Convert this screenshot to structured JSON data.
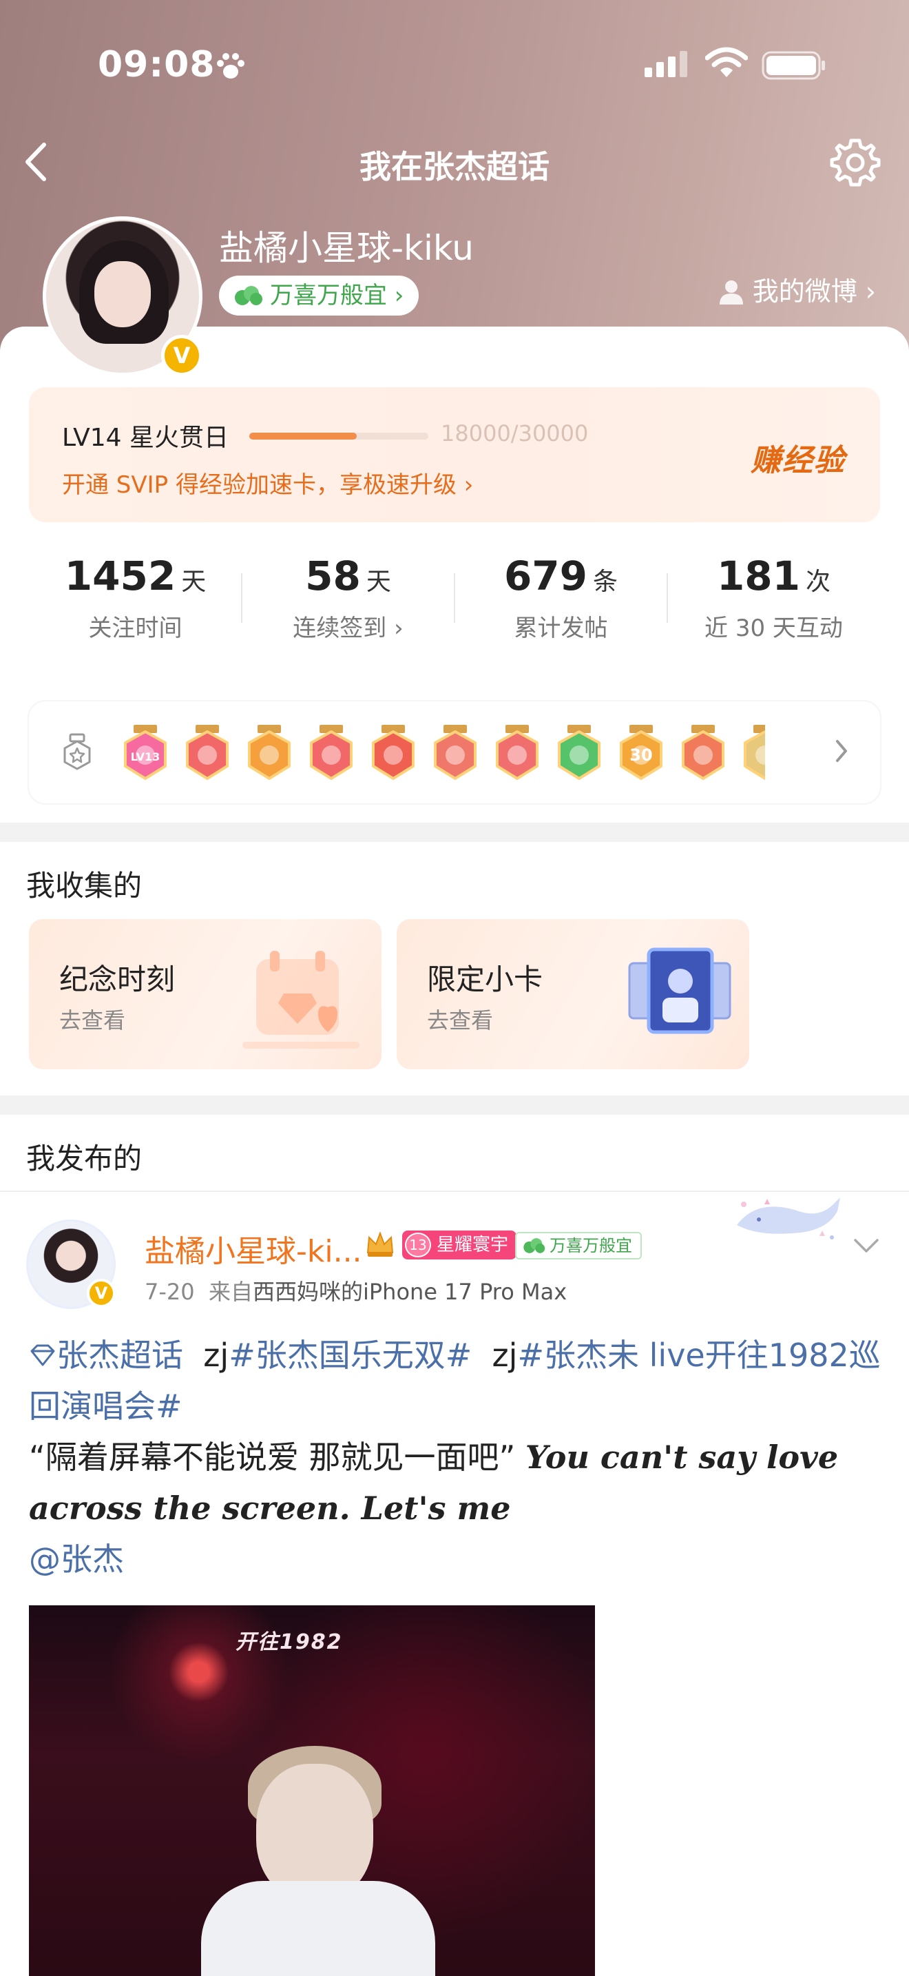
{
  "status_bar": {
    "time": "09:08"
  },
  "nav": {
    "title": "我在张杰超话"
  },
  "profile": {
    "username": "盐橘小星球-kiku",
    "fan_club": "万喜万般宜",
    "my_weibo": "我的微博",
    "verified_badge": "V"
  },
  "level": {
    "label": "LV14 星火贯日",
    "progress": "18000/30000",
    "progress_fraction": 0.6,
    "svip_text": "开通 SVIP 得经验加速卡，享极速升级",
    "earn_label": "赚经验"
  },
  "stats": [
    {
      "value": "1452",
      "unit": "天",
      "label": "关注时间"
    },
    {
      "value": "58",
      "unit": "天",
      "label": "连续签到"
    },
    {
      "value": "679",
      "unit": "条",
      "label": "累计发帖"
    },
    {
      "value": "181",
      "unit": "次",
      "label": "近 30 天互动"
    }
  ],
  "badges": {
    "colors": [
      "#f66aa0",
      "#f26868",
      "#f5a03c",
      "#f26868",
      "#f06050",
      "#f0786a",
      "#f06e6e",
      "#56c36a",
      "#f5a83a",
      "#f07a5a",
      "#e8c87a"
    ],
    "icons": [
      "lv-badge",
      "heart-badge",
      "crown-badge",
      "cat-badge",
      "rabbit-badge",
      "fox-badge",
      "panda-badge",
      "hand-badge",
      "30-days-badge",
      "hand-heart-badge",
      "badge"
    ],
    "texts": [
      "LV13",
      "",
      "",
      "",
      "",
      "",
      "",
      "",
      "30",
      "",
      ""
    ]
  },
  "collection": {
    "title": "我收集的",
    "tiles": [
      {
        "title": "纪念时刻",
        "sub": "去查看"
      },
      {
        "title": "限定小卡",
        "sub": "去查看"
      }
    ]
  },
  "published": {
    "title": "我发布的",
    "post": {
      "author": "盐橘小星球-ki...",
      "star_tag_level": "13",
      "star_tag": "星耀寰宇",
      "fan_tag": "万喜万般宜",
      "date": "7-20",
      "from_prefix": "来自",
      "device": "西西妈咪的iPhone 17 Pro Max",
      "topic1": "张杰超话",
      "seg1": "zj",
      "topic2": "#张杰国乐无双#",
      "seg2": "zj",
      "topic3": "#张杰未 live开往1982巡回演唱会#",
      "quote": "“隔着屏幕不能说爱 那就见一面吧”",
      "english": "You can't say love across the screen. Let's me",
      "mention": "@张杰",
      "image_logo": "开往1982"
    }
  }
}
